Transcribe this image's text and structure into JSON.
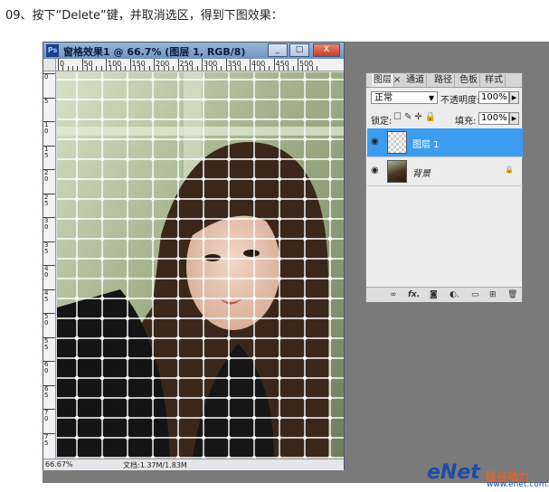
{
  "instruction": "09、按下“Delete”键，并取消选区，得到下图效果：",
  "document": {
    "title": "窗格效果1 @ 66.7% (图层 1, RGB/8)",
    "window_buttons": [
      "_",
      "□",
      "X"
    ],
    "ruler_top": [
      "0",
      "50",
      "100",
      "150",
      "200",
      "250",
      "300",
      "350",
      "400",
      "450",
      "500"
    ],
    "ruler_left": [
      "0",
      "5",
      "10",
      "15",
      "20",
      "25",
      "30",
      "35",
      "40",
      "45",
      "50",
      "55",
      "60",
      "65",
      "70",
      "75"
    ],
    "zoom": "66.67%",
    "doc_size": "文档:1.37M/1.83M"
  },
  "layers_panel": {
    "tabs": [
      "图层",
      "通道",
      "路径",
      "色板",
      "样式"
    ],
    "close_mark": "×",
    "blend_mode": "正常",
    "opacity_label": "不透明度:",
    "opacity_value": "100%",
    "lock_label": "锁定:",
    "fill_label": "填充:",
    "fill_value": "100%",
    "layers": [
      {
        "name": "图层 1",
        "selected": true
      },
      {
        "name": "背景",
        "selected": false,
        "locked": true
      }
    ]
  },
  "watermark": {
    "brand": "eNet",
    "sub": "硅谷动力",
    "url": "www.enet.com.cn"
  },
  "colors": {
    "selected_layer": "#3c9df0",
    "grid_line": "#ffffff"
  }
}
